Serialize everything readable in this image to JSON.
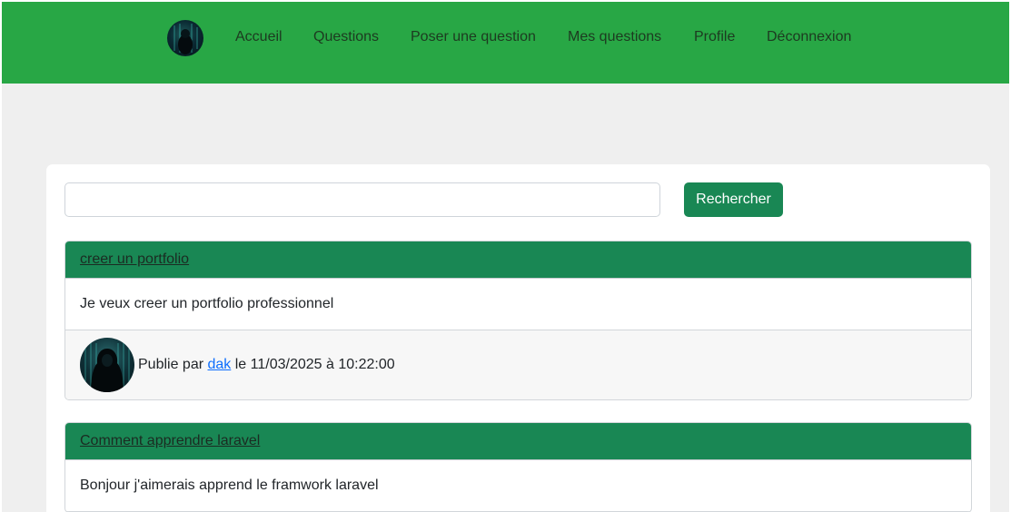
{
  "nav": {
    "items": [
      {
        "label": "Accueil"
      },
      {
        "label": "Questions"
      },
      {
        "label": "Poser une question"
      },
      {
        "label": "Mes questions"
      },
      {
        "label": "Profile"
      },
      {
        "label": "Déconnexion"
      }
    ]
  },
  "search": {
    "value": "",
    "button_label": "Rechercher"
  },
  "questions": [
    {
      "title": "creer un portfolio",
      "body": "Je veux creer un portfolio professionnel",
      "meta_prefix": "Publie par",
      "author": "dak",
      "meta_suffix": "le 11/03/2025 à 10:22:00"
    },
    {
      "title": "Comment apprendre laravel",
      "body": "Bonjour j'aimerais apprend le framwork laravel"
    }
  ],
  "colors": {
    "navbar": "#28a745",
    "card_header": "#198754",
    "button": "#198754",
    "link": "#0d6efd",
    "page_bg": "#efefef"
  }
}
